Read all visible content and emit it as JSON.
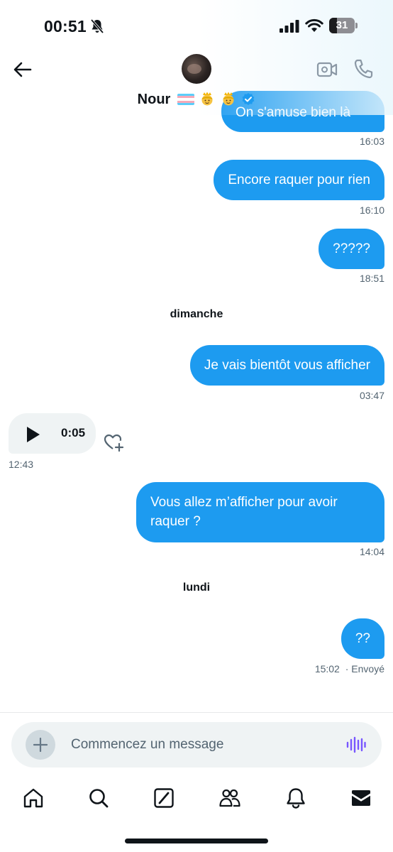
{
  "status_bar": {
    "time": "00:51",
    "battery_level": "31",
    "icons": [
      "bell-off-icon",
      "signal-icon",
      "wifi-icon",
      "battery-icon"
    ]
  },
  "header": {
    "contact_name": "Nour",
    "name_decorations": [
      "transgender-flag-emoji",
      "princess-emoji",
      "princess-emoji"
    ],
    "verified": true,
    "icons": [
      "back-arrow-icon",
      "video-call-icon",
      "phone-icon"
    ]
  },
  "messages": [
    {
      "direction": "out",
      "text": "On s'amuse bien là",
      "time": "16:03"
    },
    {
      "direction": "out",
      "text": "Encore raquer pour rien",
      "time": "16:10"
    },
    {
      "direction": "out",
      "text": "?????",
      "time": "18:51"
    },
    {
      "day_separator": "dimanche"
    },
    {
      "direction": "out",
      "text": "Je vais bientôt vous afficher",
      "time": "03:47"
    },
    {
      "direction": "in",
      "type": "audio",
      "duration": "0:05",
      "time": "12:43"
    },
    {
      "direction": "out",
      "text": "Vous allez m’afficher pour avoir raquer ?",
      "time": "14:04"
    },
    {
      "day_separator": "lundi"
    },
    {
      "direction": "out",
      "text": "??",
      "time": "15:02",
      "status": "· Envoyé"
    }
  ],
  "composer": {
    "placeholder": "Commencez un message"
  },
  "bottom_nav": {
    "items": [
      "home-icon",
      "search-icon",
      "grok-icon",
      "communities-icon",
      "notifications-icon",
      "messages-icon"
    ],
    "active": "messages-icon"
  },
  "colors": {
    "accent": "#1d9bf0",
    "incoming_bubble": "#eff3f4",
    "secondary_text": "#536471"
  }
}
